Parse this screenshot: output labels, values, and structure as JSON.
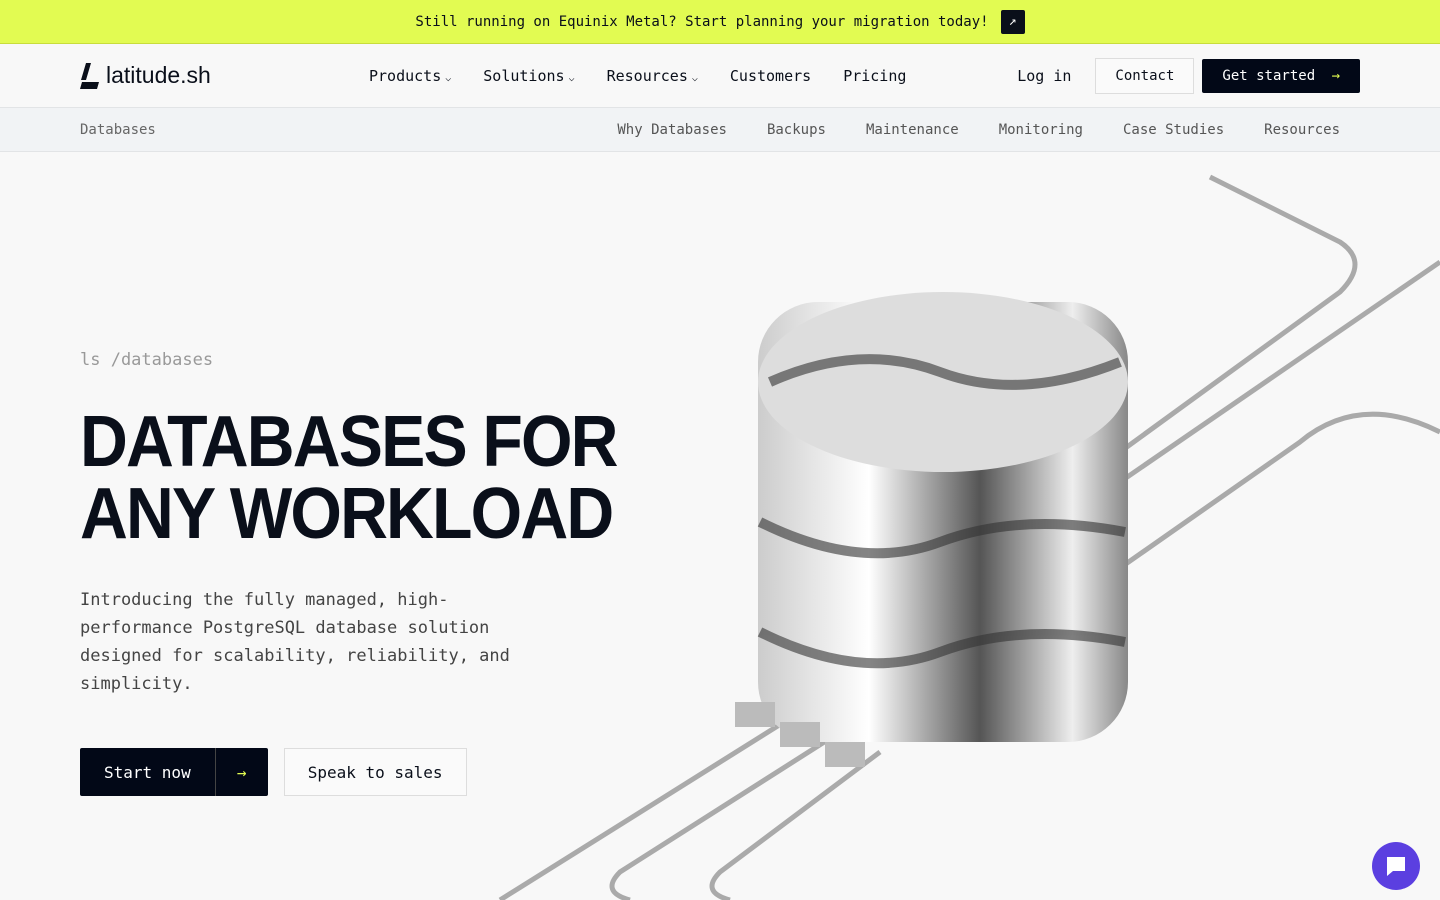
{
  "banner": {
    "text": "Still running on Equinix Metal? Start planning your migration today!"
  },
  "nav": {
    "logo": "latitude.sh",
    "items": [
      "Products",
      "Solutions",
      "Resources",
      "Customers",
      "Pricing"
    ],
    "login": "Log in",
    "contact": "Contact",
    "get_started": "Get started"
  },
  "subnav": {
    "title": "Databases",
    "items": [
      "Why Databases",
      "Backups",
      "Maintenance",
      "Monitoring",
      "Case Studies",
      "Resources"
    ]
  },
  "hero": {
    "command": "ls /databases",
    "title_line1": "Databases for",
    "title_line2": "any workload",
    "description": "Introducing the fully managed, high-performance PostgreSQL database solution designed for scalability, reliability, and simplicity.",
    "start": "Start now",
    "sales": "Speak to sales"
  }
}
